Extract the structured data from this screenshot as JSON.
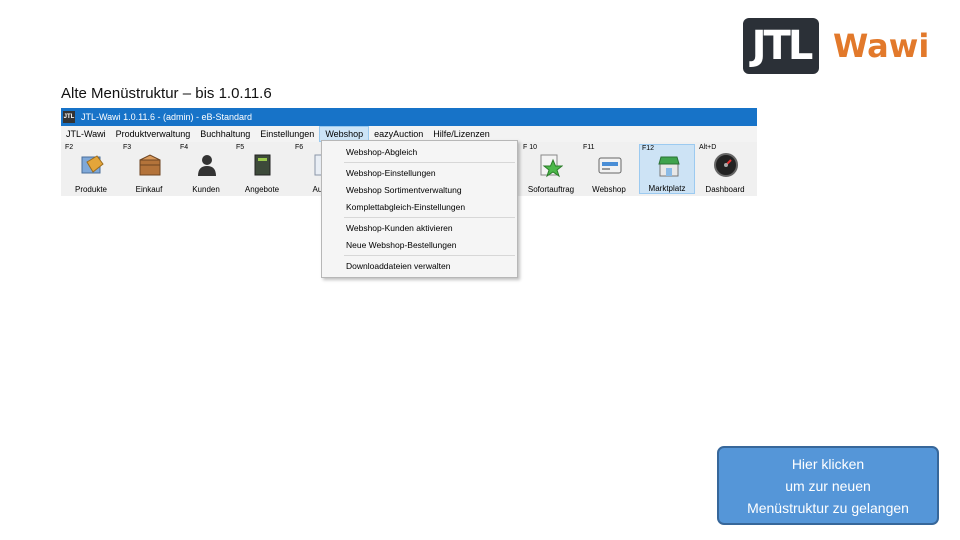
{
  "logo": {
    "jtl": "JTL",
    "wawi": "Wawi",
    "brand_color": "#e2792b",
    "box_color": "#2b3037"
  },
  "slide_title": "Alte Menüstruktur – bis 1.0.11.6",
  "app": {
    "window_title": "JTL-Wawi 1.0.11.6 - (admin) - eB-Standard",
    "window_icon": "JTL",
    "titlebar_color": "#1773c8",
    "menu": [
      "JTL-Wawi",
      "Produktverwaltung",
      "Buchhaltung",
      "Einstellungen",
      "Webshop",
      "eazyAuction",
      "Hilfe/Lizenzen"
    ],
    "active_menu": "Webshop",
    "toolbar": [
      {
        "key": "F2",
        "label": "Produkte",
        "icon": "product-tag-icon"
      },
      {
        "key": "F3",
        "label": "Einkauf",
        "icon": "crate-icon"
      },
      {
        "key": "F4",
        "label": "Kunden",
        "icon": "customer-icon"
      },
      {
        "key": "F5",
        "label": "Angebote",
        "icon": "offer-book-icon"
      },
      {
        "key": "F6",
        "label": "Auftr",
        "icon": "order-icon"
      },
      {
        "key": "",
        "label": "r",
        "icon": ""
      },
      {
        "key": "F 10",
        "label": "Sofortauftrag",
        "icon": "instant-order-icon"
      },
      {
        "key": "F11",
        "label": "Webshop",
        "icon": "webshop-icon"
      },
      {
        "key": "F12",
        "label": "Marktplatz",
        "icon": "marketplace-icon"
      },
      {
        "key": "Alt+D",
        "label": "Dashboard",
        "icon": "dashboard-gauge-icon"
      }
    ],
    "dropdown": [
      "Webshop-Abgleich",
      "Webshop-Einstellungen",
      "Webshop Sortimentverwaltung",
      "Komplettabgleich-Einstellungen",
      "Webshop-Kunden aktivieren",
      "Neue Webshop-Bestellungen",
      "Downloaddateien verwalten"
    ]
  },
  "cta": {
    "line1": "Hier klicken",
    "line2": "um zur neuen",
    "line3": "Menüstruktur zu gelangen",
    "color": "#5596d8"
  }
}
